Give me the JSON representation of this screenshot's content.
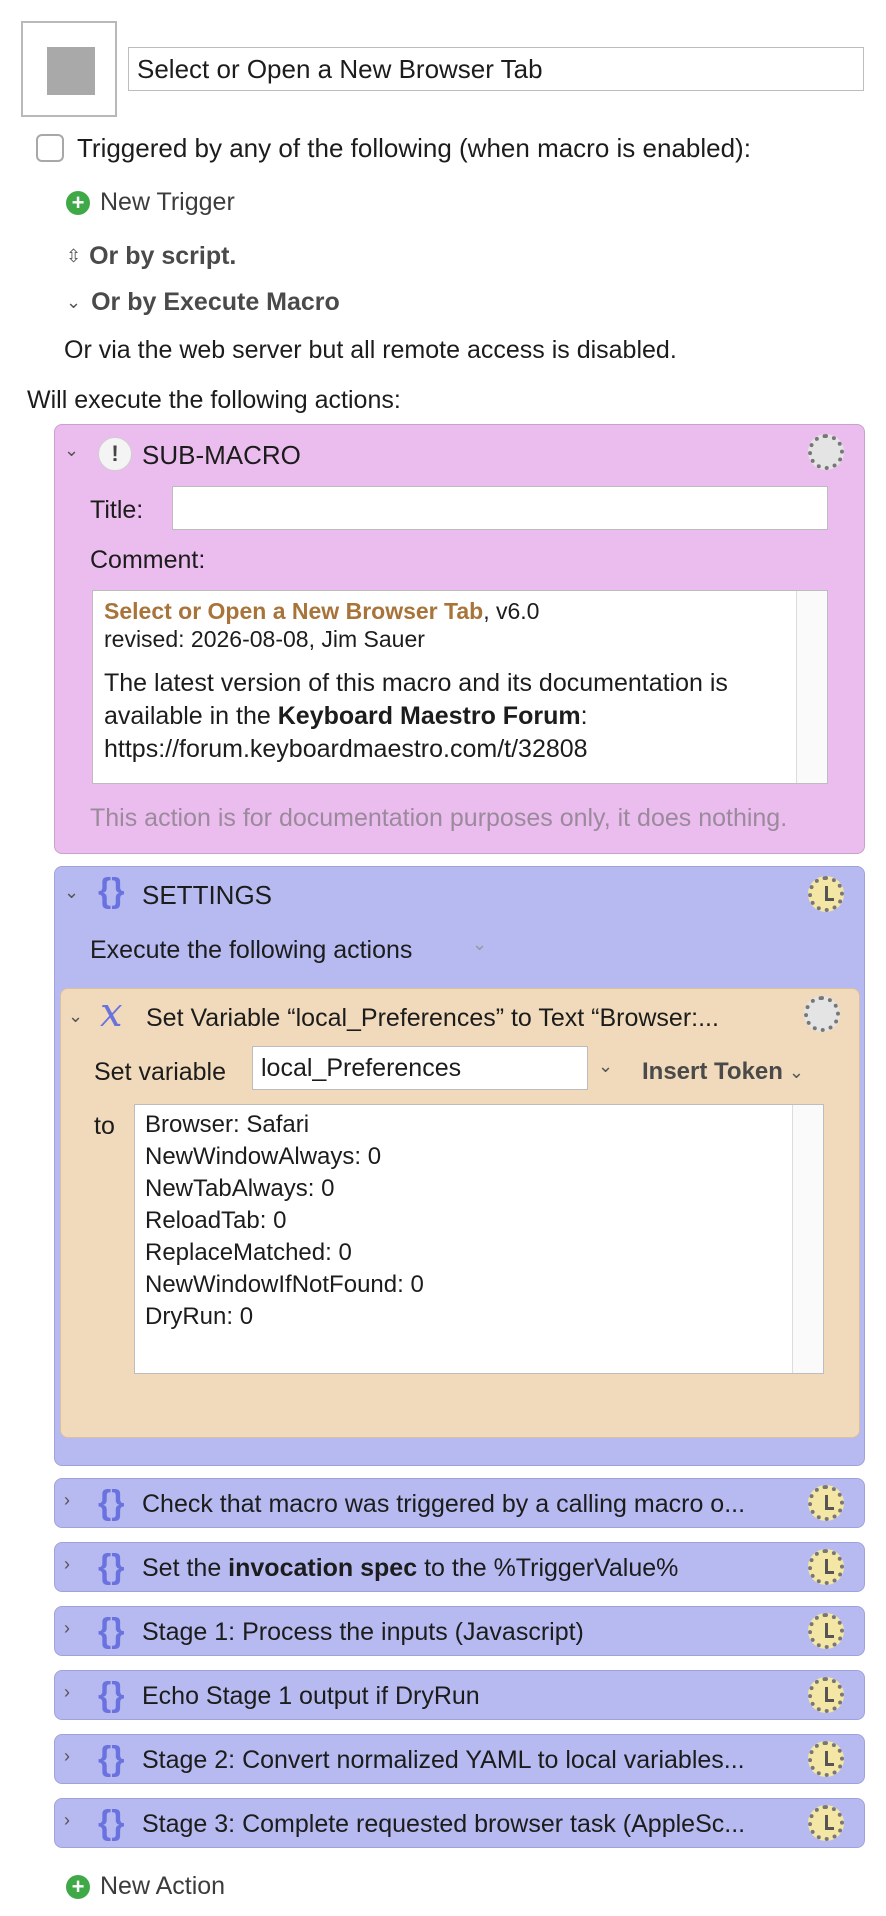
{
  "macro": {
    "name": "Select or Open a New Browser Tab"
  },
  "triggers": {
    "triggered_by_label": "Triggered by any of the following (when macro is enabled):",
    "new_trigger_label": "New Trigger",
    "or_by_script_label": "Or by script.",
    "or_by_execute_label": "Or by Execute Macro",
    "web_server_note": "Or via the web server but all remote access is disabled."
  },
  "actions_heading": "Will execute the following actions:",
  "submacro": {
    "label": "SUB-MACRO",
    "title_label": "Title:",
    "title_value": "",
    "comment_label": "Comment:",
    "comment_title": "Select or Open a New Browser Tab",
    "comment_version": ", v6.0",
    "comment_revised": "revised: 2026-08-08, Jim Sauer",
    "comment_line1": "The latest version of this macro and its documentation is",
    "comment_line2_pre": "available in the ",
    "comment_line2_bold": "Keyboard Maestro Forum",
    "comment_line2_post": ":",
    "comment_url": "https://forum.keyboardmaestro.com/t/32808",
    "note": "This action is for documentation purposes only, it does nothing."
  },
  "settings": {
    "label": "SETTINGS",
    "execute_label": "Execute the following actions"
  },
  "set_variable": {
    "title": "Set Variable “local_Preferences” to Text “Browser:...",
    "set_variable_label": "Set variable",
    "variable_name": "local_Preferences",
    "insert_token_label": "Insert Token",
    "to_label": "to",
    "value_lines": [
      "Browser: Safari",
      "NewWindowAlways: 0",
      "NewTabAlways: 0",
      "ReloadTab: 0",
      "ReplaceMatched: 0",
      "NewWindowIfNotFound: 0",
      "DryRun: 0"
    ]
  },
  "groups": [
    {
      "label": "Check that macro was triggered by a calling macro o..."
    },
    {
      "label_pre": "Set the ",
      "label_bold": "invocation spec",
      "label_post": " to the %TriggerValue%"
    },
    {
      "label": "Stage 1: Process the inputs (Javascript)"
    },
    {
      "label": "Echo Stage 1 output if DryRun"
    },
    {
      "label": "Stage 2: Convert normalized YAML to local variables..."
    },
    {
      "label": "Stage 3: Complete requested browser task (AppleSc..."
    }
  ],
  "new_action_label": "New Action"
}
